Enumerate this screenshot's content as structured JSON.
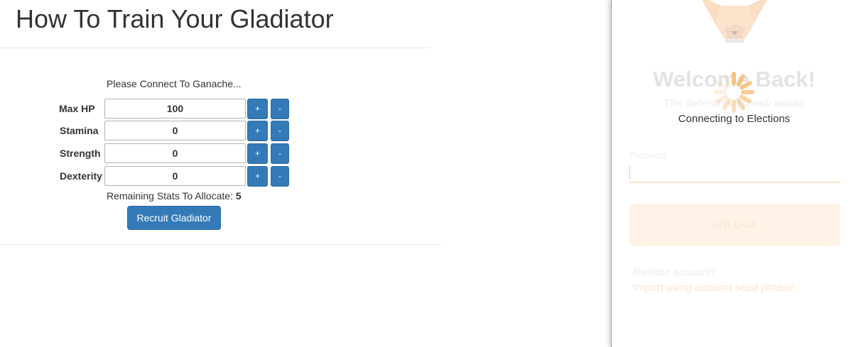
{
  "page": {
    "title": "How To Train Your Gladiator",
    "status_text": "Please Connect To Ganache..."
  },
  "stats": [
    {
      "label": "Max HP",
      "value": "100",
      "plus": "+",
      "minus": "-"
    },
    {
      "label": "Stamina",
      "value": "0",
      "plus": "+",
      "minus": "-"
    },
    {
      "label": "Strength",
      "value": "0",
      "plus": "+",
      "minus": "-"
    },
    {
      "label": "Dexterity",
      "value": "0",
      "plus": "+",
      "minus": "-"
    }
  ],
  "remaining": {
    "label": "Remaining Stats To Allocate:",
    "value": "5"
  },
  "recruit_button": "Recruit Gladiator",
  "extension": {
    "welcome": "Welcome Back!",
    "tagline": "The decentralized web awaits",
    "connecting": "Connecting to Elections",
    "password_label": "Password",
    "unlock_button": "UNLOCK",
    "restore_text": "Restore account?",
    "import_link": "Import using account seed phrase",
    "icons": [
      "fox-logo-icon",
      "loading-spinner-icon"
    ]
  },
  "colors": {
    "primary_button": "#337ab7",
    "text": "#333333",
    "extension_accent": "#f6851b"
  }
}
